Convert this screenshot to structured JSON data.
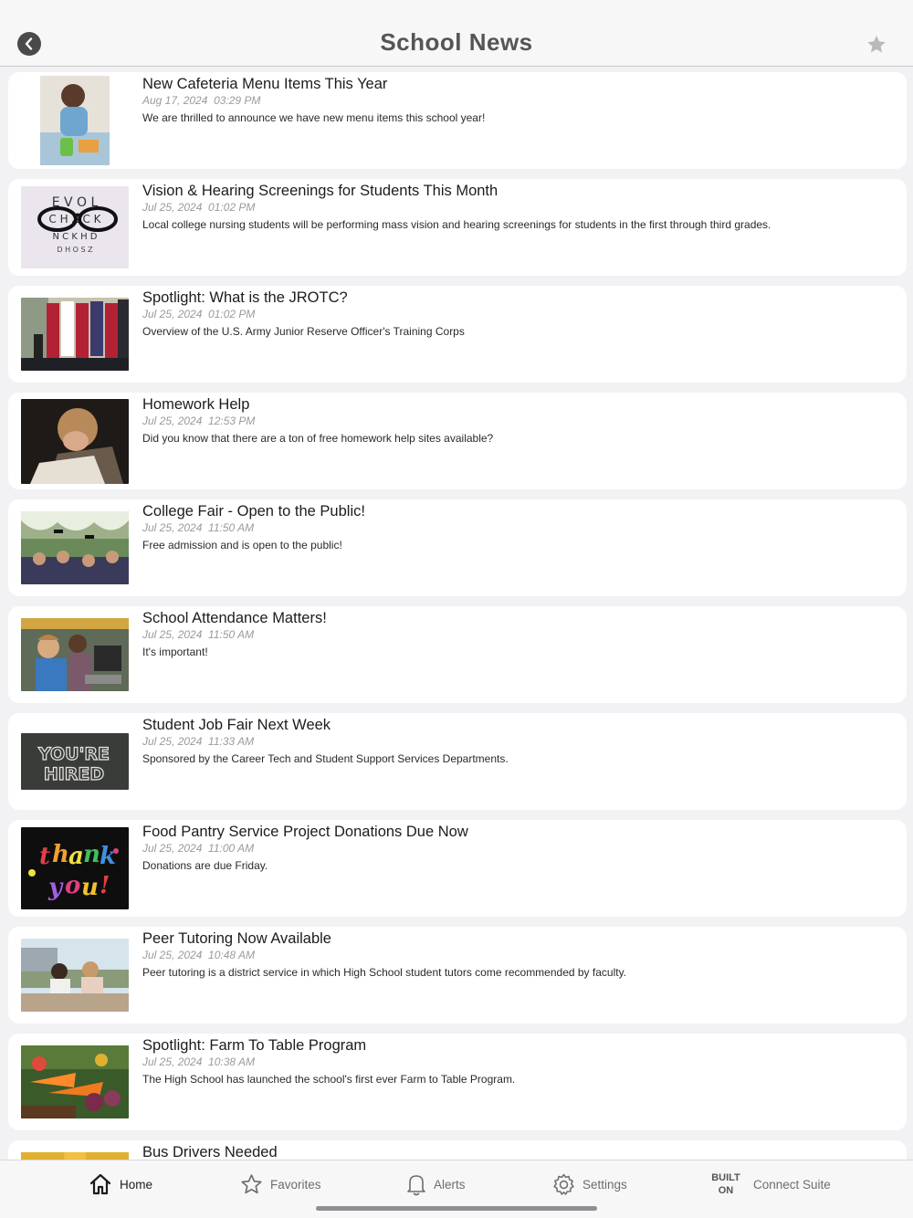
{
  "header": {
    "title": "School News"
  },
  "news": [
    {
      "title": "New Cafeteria Menu Items This Year",
      "date": "Aug 17, 2024  03:29 PM",
      "description": "We are thrilled to announce we have new menu items this school year!",
      "icon": "cafeteria-photo"
    },
    {
      "title": "Vision & Hearing Screenings for Students This Month",
      "date": "Jul 25, 2024  01:02 PM",
      "description": "Local college nursing students will be performing mass vision and hearing screenings for students in the first through third grades.",
      "icon": "eye-chart-photo"
    },
    {
      "title": "Spotlight: What is the JROTC?",
      "date": "Jul 25, 2024  01:02 PM",
      "description": "Overview of the U.S. Army Junior Reserve Officer's Training Corps",
      "icon": "flags-photo"
    },
    {
      "title": "Homework Help",
      "date": "Jul 25, 2024  12:53 PM",
      "description": "Did you know that there are a ton of free homework help sites available?",
      "icon": "homework-photo"
    },
    {
      "title": "College Fair - Open to the Public!",
      "date": "Jul 25, 2024  11:50 AM",
      "description": "Free admission and is open to the public!",
      "icon": "graduation-photo"
    },
    {
      "title": "School Attendance Matters!",
      "date": "Jul 25, 2024  11:50 AM",
      "description": "It's important!",
      "icon": "classroom-photo"
    },
    {
      "title": "Student Job Fair Next Week",
      "date": "Jul 25, 2024  11:33 AM",
      "description": "Sponsored by the Career Tech and Student Support Services Departments.",
      "icon": "chalkboard-photo",
      "image_text": "YOU'RE HIRED"
    },
    {
      "title": "Food Pantry Service Project Donations Due Now",
      "date": "Jul 25, 2024  11:00 AM",
      "description": "Donations are due Friday.",
      "icon": "thank-you-photo",
      "image_text": "thank you!"
    },
    {
      "title": "Peer Tutoring Now Available",
      "date": "Jul 25, 2024  10:48 AM",
      "description": "Peer tutoring is a district service in which High School student tutors come recommended by faculty.",
      "icon": "tutoring-photo"
    },
    {
      "title": "Spotlight: Farm To Table Program",
      "date": "Jul 25, 2024  10:38 AM",
      "description": "The High School has launched the school's first ever Farm to Table Program.",
      "icon": "vegetables-photo"
    },
    {
      "title": "Bus Drivers Needed",
      "date": "",
      "description": "",
      "icon": "bus-photo"
    }
  ],
  "tabbar": {
    "home": "Home",
    "favorites": "Favorites",
    "alerts": "Alerts",
    "settings": "Settings",
    "built_on": "BUILT\nON",
    "connect": "Connect Suite"
  },
  "colors": {
    "background": "#f2f2f4",
    "card": "#ffffff",
    "title": "#555557",
    "date": "#9a9aa0"
  }
}
